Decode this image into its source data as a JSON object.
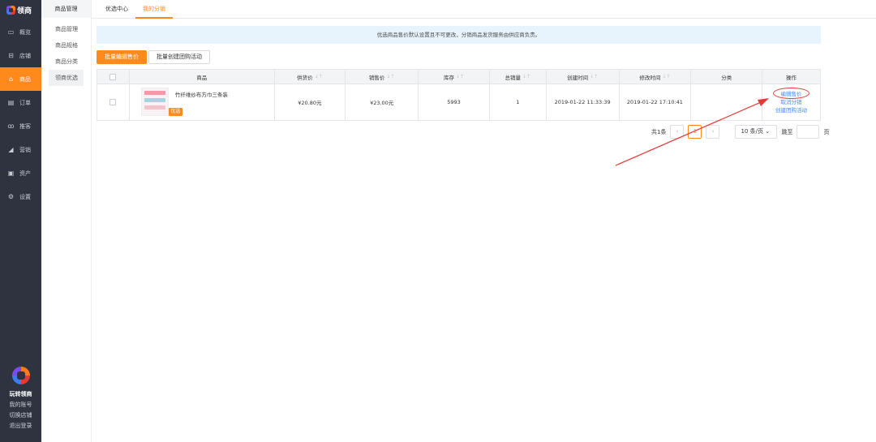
{
  "app": {
    "logo_text": "领商"
  },
  "sidebar": {
    "items": [
      {
        "label": "概览",
        "icon": "monitor-icon"
      },
      {
        "label": "店铺",
        "icon": "store-icon"
      },
      {
        "label": "商品",
        "icon": "bag-icon",
        "active": true
      },
      {
        "label": "订单",
        "icon": "order-icon"
      },
      {
        "label": "推客",
        "icon": "user-group-icon"
      },
      {
        "label": "营销",
        "icon": "chart-icon"
      },
      {
        "label": "资产",
        "icon": "asset-icon"
      },
      {
        "label": "设置",
        "icon": "gear-icon"
      }
    ],
    "bottom": {
      "title": "玩转领商",
      "links": [
        "我的账号",
        "切换店铺",
        "退出登录"
      ]
    }
  },
  "subnav": {
    "title": "商品管理",
    "items": [
      "商品管理",
      "商品规格",
      "商品分类",
      "领商优选"
    ]
  },
  "tabs": [
    "优选中心",
    "我的分销"
  ],
  "notice": "优选商品售价默认设置且不可更改，分销商品发货服务由供应商负责。",
  "toolbar": {
    "batch_edit_price": "批量编辑售价",
    "batch_create_group": "批量创建团购活动"
  },
  "table": {
    "headers": [
      "商品",
      "供货价",
      "销售价",
      "库存",
      "总销量",
      "创建时间",
      "修改时间",
      "分类",
      "操作"
    ],
    "rows": [
      {
        "name": "竹纤维纱布方巾三条装",
        "tag": "优选",
        "supply_price": "¥20.80元",
        "sale_price": "¥23.00元",
        "stock": "5993",
        "total_sales": "1",
        "created": "2019-01-22 11:33:39",
        "modified": "2019-01-22 17:10:41",
        "category": "",
        "actions": [
          "编辑售价",
          "取消分销",
          "创建团购活动"
        ]
      }
    ]
  },
  "pagination": {
    "total": "共1条",
    "current": "1",
    "page_size": "10 条/页",
    "goto": "跳至",
    "page_unit": "页"
  },
  "colors": {
    "accent": "#ff8a1c",
    "sidebar_bg": "#2f3340",
    "link": "#3d8bfd",
    "annotation": "#e53935"
  }
}
